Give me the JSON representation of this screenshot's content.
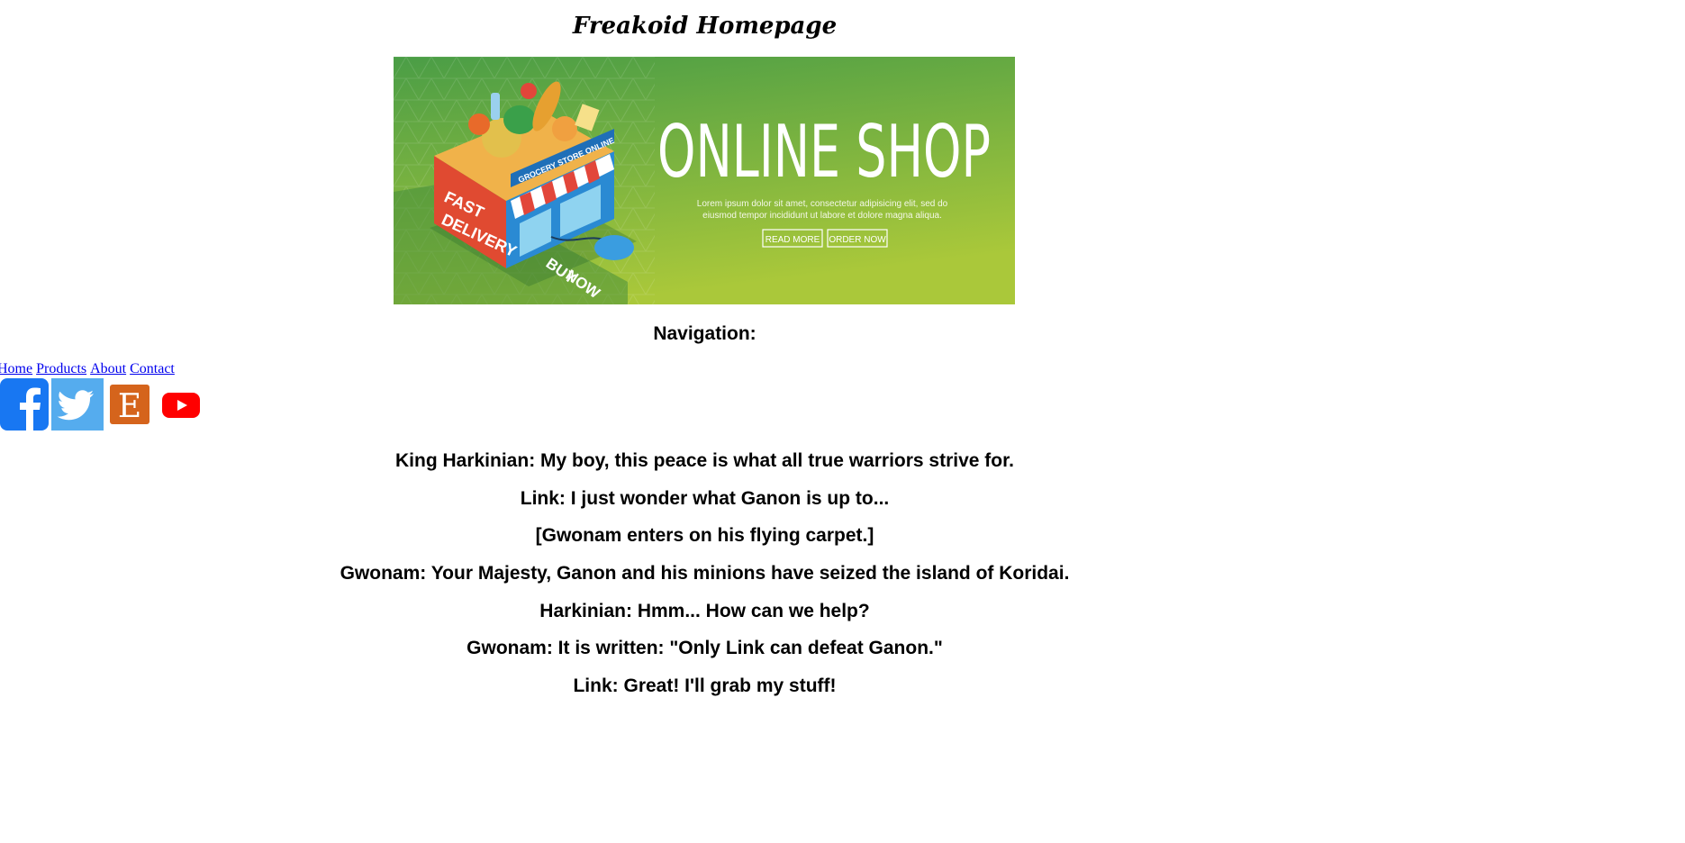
{
  "page": {
    "title": "Freakoid Homepage",
    "nav_heading": "Navigation:"
  },
  "banner": {
    "headline": "ONLINE SHOP",
    "subtext_line1": "Lorem ipsum dolor sit amet, consectetur adipisicing elit, sed do",
    "subtext_line2": "eiusmod tempor incididunt ut labore et dolore magna aliqua.",
    "read_more": "READ MORE",
    "order_now": "ORDER NOW",
    "store_sign": "GROCERY STORE ONLINE",
    "delivery_line1": "FAST",
    "delivery_line2": "DELIVERY",
    "buy_line1": "BUY",
    "buy_line2": "NOW",
    "colors": {
      "green_top": "#4c9f47",
      "green_bottom": "#a8c83a",
      "store_red": "#e24a32",
      "store_blue": "#2b8fd6"
    }
  },
  "nav": {
    "links": [
      "Home",
      "Products",
      "About",
      "Contact"
    ]
  },
  "social": {
    "icons": [
      "facebook-icon",
      "twitter-icon",
      "etsy-icon",
      "youtube-icon"
    ],
    "etsy_letter": "E",
    "colors": {
      "facebook": "#1877f2",
      "twitter": "#55acee",
      "etsy": "#d5641c",
      "youtube": "#ff0000"
    }
  },
  "dialogue": [
    "King Harkinian: My boy, this peace is what all true warriors strive for.",
    "Link: I just wonder what Ganon is up to...",
    "[Gwonam enters on his flying carpet.]",
    "Gwonam: Your Majesty, Ganon and his minions have seized the island of Koridai.",
    "Harkinian: Hmm... How can we help?",
    "Gwonam: It is written: \"Only Link can defeat Ganon.\"",
    "Link: Great! I'll grab my stuff!"
  ]
}
